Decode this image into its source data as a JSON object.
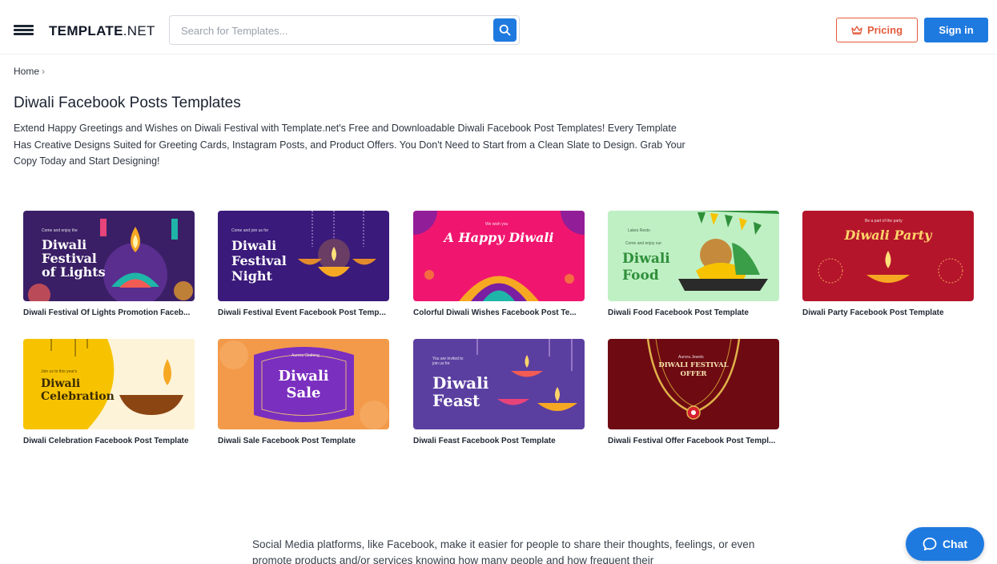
{
  "header": {
    "logo_bold": "TEMPLATE",
    "logo_light": ".NET",
    "search_placeholder": "Search for Templates...",
    "pricing_label": "Pricing",
    "signin_label": "Sign in"
  },
  "breadcrumb": {
    "home": "Home",
    "separator": "›"
  },
  "page": {
    "title": "Diwali Facebook Posts Templates",
    "intro": "Extend Happy Greetings and Wishes on Diwali Festival with Template.net's Free and Downloadable Diwali Facebook Post Templates! Every Template Has Creative Designs Suited for Greeting Cards, Instagram Posts, and Product Offers. You Don't Need to Start from a Clean Slate to Design. Grab Your Copy Today and Start Designing!"
  },
  "templates": [
    {
      "label": "Diwali Festival Of Lights Promotion Faceb...",
      "thumb_small": "Come and enjoy the",
      "thumb_title_1": "Diwali",
      "thumb_title_2": "Festival",
      "thumb_title_3": "of Lights",
      "bg": "#3b1f66"
    },
    {
      "label": "Diwali Festival Event Facebook Post Temp...",
      "thumb_small": "Come and join us for",
      "thumb_title_1": "Diwali",
      "thumb_title_2": "Festival",
      "thumb_title_3": "Night",
      "bg": "#3a1a7a"
    },
    {
      "label": "Colorful Diwali Wishes Facebook Post Te...",
      "thumb_small": "We wish you",
      "thumb_title_1": "A Happy Diwali",
      "bg": "#f0166f"
    },
    {
      "label": "Diwali Food Facebook Post Template",
      "thumb_small": "Lakes Resto",
      "thumb_small_2": "Come and enjoy our",
      "thumb_title_1": "Diwali",
      "thumb_title_2": "Food",
      "bg": "#bff0c4"
    },
    {
      "label": "Diwali Party Facebook Post Template",
      "thumb_small": "Be a part of the party",
      "thumb_title_1": "Diwali Party",
      "bg": "#b5152b"
    },
    {
      "label": "Diwali Celebration Facebook Post Template",
      "thumb_small": "Join us to this year's",
      "thumb_title_1": "Diwali",
      "thumb_title_2": "Celebration",
      "bg": "#f7c300"
    },
    {
      "label": "Diwali Sale Facebook Post Template",
      "thumb_small": "Aurora Clothing",
      "thumb_title_1": "Diwali",
      "thumb_title_2": "Sale",
      "bg": "#f39a4a"
    },
    {
      "label": "Diwali Feast Facebook Post Template",
      "thumb_small": "You are invited to join us for",
      "thumb_title_1": "Diwali",
      "thumb_title_2": "Feast",
      "bg": "#5b3fa0"
    },
    {
      "label": "Diwali Festival Offer Facebook Post Templ...",
      "thumb_small": "Aurora Jewels",
      "thumb_title_1": "DIWALI FESTIVAL",
      "thumb_title_2": "OFFER",
      "bg": "#6e0a12"
    }
  ],
  "bottom": {
    "text": "Social Media platforms, like Facebook, make it easier for people to share their thoughts, feelings, or even promote products and/or services knowing how many people and how frequent their"
  },
  "chat": {
    "label": "Chat"
  },
  "colors": {
    "accent_blue": "#1f7ae0",
    "pricing_orange": "#e45b3b"
  }
}
